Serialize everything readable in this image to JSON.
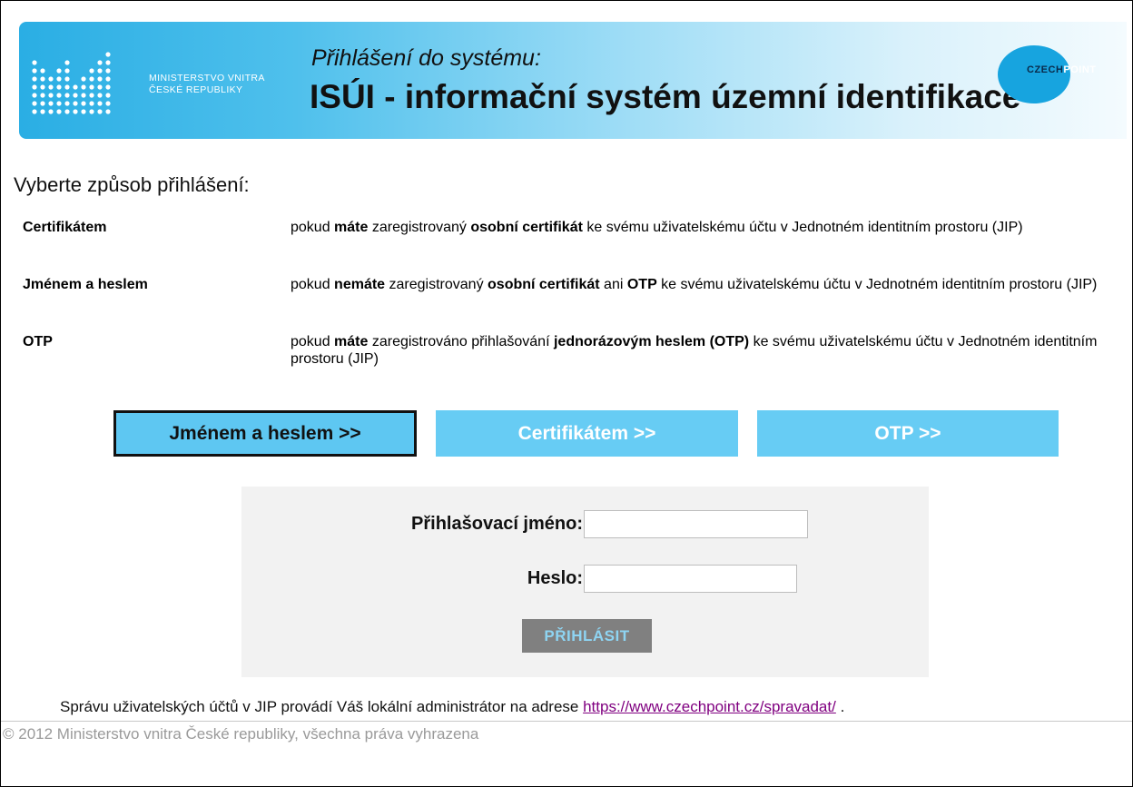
{
  "header": {
    "ministry_line1": "MINISTERSTVO VNITRA",
    "ministry_line2": "ČESKÉ REPUBLIKY",
    "subtitle": "Přihlášení do systému:",
    "title": "ISÚI - informační systém územní identifikace",
    "czechpoint_part1": "CZECH",
    "czechpoint_part2": "POINT",
    "banner_color": "#2aaee4"
  },
  "intro": "Vyberte způsob přihlášení:",
  "methods": [
    {
      "name": "Certifikátem",
      "desc_parts": [
        "pokud ",
        "máte",
        " zaregistrovaný ",
        "osobní certifikát",
        " ke svému uživatelskému účtu v Jednotném identitním prostoru (JIP)"
      ]
    },
    {
      "name": "Jménem a heslem",
      "desc_parts": [
        "pokud ",
        "nemáte",
        " zaregistrovaný ",
        "osobní certifikát",
        " ani ",
        "OTP",
        " ke svému uživatelskému účtu v Jednotném identitním prostoru (JIP)"
      ]
    },
    {
      "name": "OTP",
      "desc_parts": [
        "pokud ",
        "máte",
        " zaregistrováno přihlašování ",
        "jednorázovým heslem (OTP)",
        " ke svému uživatelskému účtu v Jednotném identitním prostoru (JIP)"
      ]
    }
  ],
  "tabs": {
    "name_password": "Jménem a heslem >>",
    "certificate": "Certifikátem >>",
    "otp": "OTP >>",
    "active": "name_password"
  },
  "form": {
    "username_label": "Přihlašovací jméno:",
    "username_value": "",
    "password_label": "Heslo:",
    "password_value": "",
    "submit_label": "PŘIHLÁSIT"
  },
  "footer": {
    "note_text": "Správu uživatelských účtů v JIP provádí Váš lokální administrátor na adrese ",
    "note_link": "https://www.czechpoint.cz/spravadat/",
    "note_end": " .",
    "copyright": "© 2012 Ministerstvo vnitra České republiky, všechna práva vyhrazena"
  },
  "colors": {
    "tab_active_bg": "#5ec7f2",
    "tab_bg": "#67ccf4",
    "submit_bg": "#808080",
    "link": "#800080"
  }
}
